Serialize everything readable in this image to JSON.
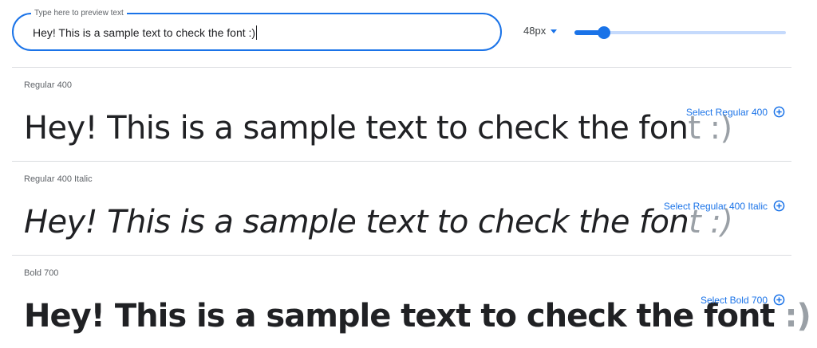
{
  "preview": {
    "legend": "Type here to preview text",
    "value": "Hey! This is a sample text to check the font :)"
  },
  "size": {
    "label": "48px",
    "slider_fraction": 0.14
  },
  "styles": [
    {
      "name": "Regular 400",
      "sample_main": "Hey! This is a sample text to check the fon",
      "sample_fade": "t :)",
      "select_label": "Select Regular 400"
    },
    {
      "name": "Regular 400 Italic",
      "sample_main": "Hey! This is a sample text to check the fon",
      "sample_fade": "t :)",
      "select_label": "Select Regular 400 Italic"
    },
    {
      "name": "Bold 700",
      "sample_main": "Hey! This is a sample text to check the font",
      "sample_fade": " :)",
      "select_label": "Select Bold 700"
    }
  ],
  "icons": {
    "size_dropdown": "arrow-drop-down-icon",
    "select": "add-circle-icon"
  },
  "colors": {
    "accent": "#1a73e8",
    "text": "#202124",
    "muted": "#5f6368",
    "fade": "#9aa0a6"
  }
}
